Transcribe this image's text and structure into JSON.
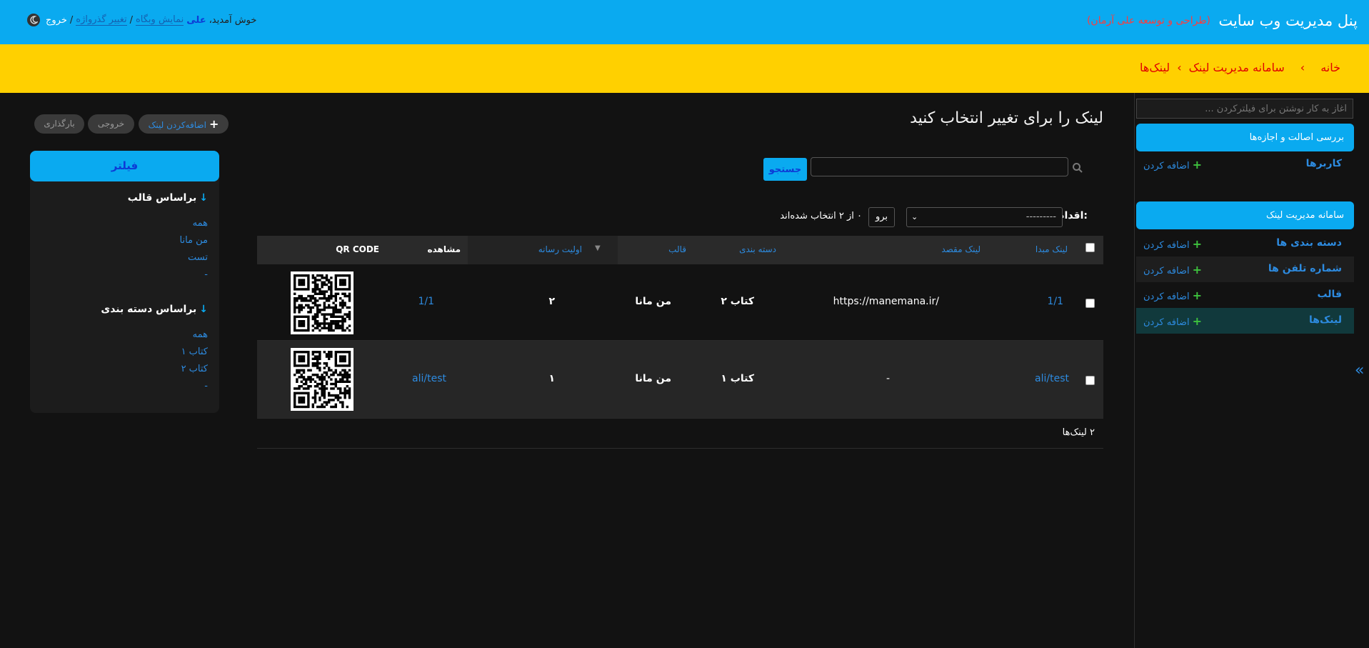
{
  "header": {
    "site_name": "پنل مدیریت وب سایت",
    "credit": "(طراحی و توسعه علی آرمان)",
    "welcome": "خوش آمدید،",
    "username": "علی",
    "view_site": "نمایش وبگاه",
    "change_password": "تغییر گذرواژه",
    "logout": "خروج",
    "slash": "/",
    "theme_icon": "moon-icon"
  },
  "breadcrumbs": {
    "home": "خانه",
    "app": "سامانه مدیریت لینک",
    "current": "لینک‌ها",
    "sep1": "›",
    "sep2": "›"
  },
  "sidebar": {
    "filter_placeholder": "آغاز به کار نوشتن برای فیلترکردن ...",
    "auth_caption": "بررسی اصالت و اجازه‌ها",
    "auth_items": [
      {
        "name": "کاربرها",
        "add": "اضافه کردن"
      }
    ],
    "app_caption": "سامانه مدیریت لینک",
    "app_items": [
      {
        "name": "دسته بندی ها",
        "add": "اضافه کردن"
      },
      {
        "name": "شماره تلفن ها",
        "add": "اضافه کردن"
      },
      {
        "name": "قالب",
        "add": "اضافه کردن"
      },
      {
        "name": "لینک‌ها",
        "add": "اضافه کردن"
      }
    ],
    "toggle": "«",
    "plus": "+"
  },
  "content": {
    "title": "لینک را برای تغییر انتخاب کنید",
    "tools": {
      "add": "اضافه‌کردن لینک",
      "export": "خروجی",
      "import": "بارگذاری",
      "plus": "+"
    },
    "search": {
      "value": "",
      "button": "جستجو"
    },
    "actions": {
      "label": "اقدام:",
      "selected": "---------",
      "go": "برو",
      "counter": "۰ از ۲ انتخاب شده‌اند",
      "caret": "⌄"
    }
  },
  "table": {
    "headers": {
      "source": "لینک مبدا",
      "target": "لینک مقصد",
      "category": "دسته بندی",
      "template": "قالب",
      "priority": "اولیت رسانه",
      "view": "مشاهده",
      "qr": "QR CODE",
      "sort_icon": "▼"
    },
    "rows": [
      {
        "source": "1/1",
        "target": "https://manemana.ir/",
        "category": "کتاب ۲",
        "template": "من مانا",
        "priority": "۲",
        "view": "1/1"
      },
      {
        "source": "ali/test",
        "target": "-",
        "category": "کتاب ۱",
        "template": "من مانا",
        "priority": "۱",
        "view": "ali/test"
      }
    ],
    "paginator": "۲ لینک‌ها"
  },
  "filter": {
    "title": "فیلتر",
    "arrow": "↓",
    "groups": [
      {
        "heading": "براساس قالب",
        "options": [
          "همه",
          "من مانا",
          "تست",
          "-"
        ]
      },
      {
        "heading": "براساس دسته بندی",
        "options": [
          "همه",
          "کتاب ۱",
          "کتاب ۲",
          "-"
        ]
      }
    ]
  },
  "colors": {
    "header_bg": "#0aaaf0",
    "breadcrumb_bg": "#ffd000",
    "breadcrumb_text": "#e00000",
    "link": "#2d8be0",
    "add_plus": "#3ec23e",
    "page_bg": "#121212"
  }
}
